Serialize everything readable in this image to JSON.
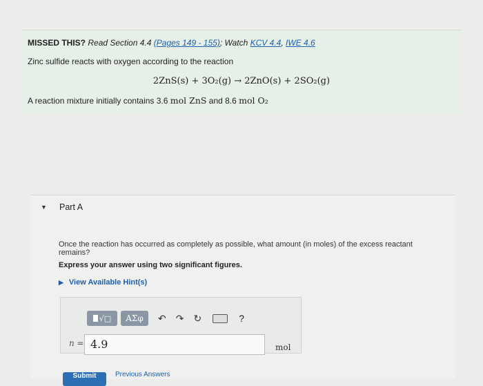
{
  "intro": {
    "missed_label": "MISSED THIS?",
    "read_section": "Read Section 4.4",
    "pages_link": "(Pages 149 - 155)",
    "watch_label": "; Watch",
    "kcv_link": "KCV 4.4",
    "iwe_link": "IWE 4.6",
    "statement": "Zinc sulfide reacts with oxygen according to the reaction",
    "equation": "2ZnS(s) + 3O₂(g) → 2ZnO(s) + 2SO₂(g)",
    "mixture_text": "A reaction mixture initially contains 3.6",
    "mixture_unit1": "mol ZnS",
    "mixture_and": "and 8.6",
    "mixture_unit2": "mol O₂"
  },
  "part": {
    "title": "Part A",
    "question": "Once the reaction has occurred as completely as possible, what amount (in moles) of the excess reactant remains?",
    "instruction": "Express your answer using two significant figures.",
    "hint_link": "View Available Hint(s)"
  },
  "answer": {
    "variable": "n =",
    "value": "4.9",
    "unit": "mol",
    "greek_button": "ΑΣφ",
    "help": "?"
  },
  "actions": {
    "submit": "Submit",
    "previous": "Previous Answers"
  },
  "colors": {
    "intro_bg": "#e6efe8",
    "link": "#1c5fae",
    "submit_bg": "#2d6fb4",
    "toolbar_btn": "#8a96a3"
  }
}
